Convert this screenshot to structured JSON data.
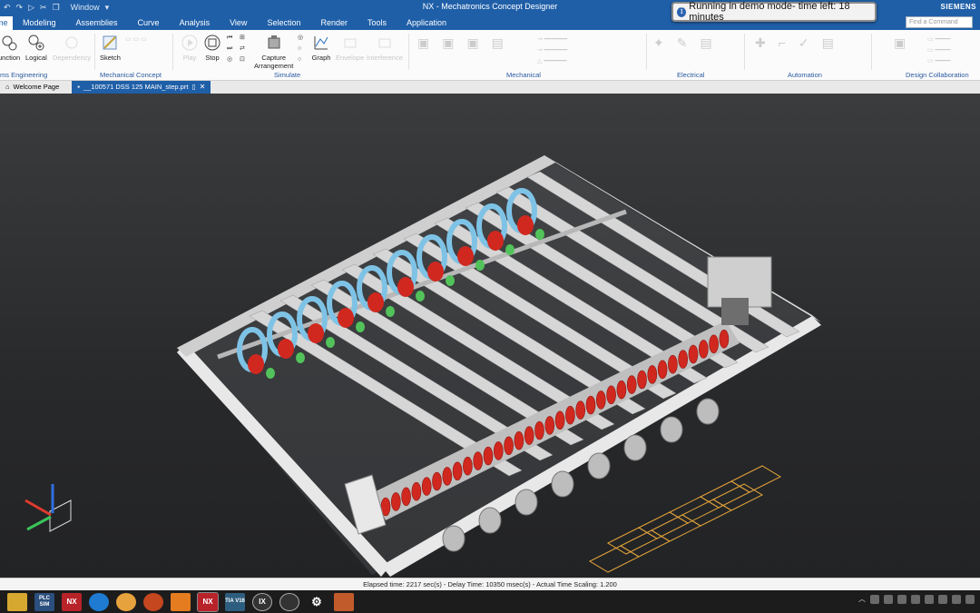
{
  "titlebar": {
    "window_menu": "Window",
    "app_title": "NX - Mechatronics Concept Designer",
    "demo_notice": "Running in demo mode- time left: 18 minutes",
    "brand": "SIEMENS"
  },
  "menu": {
    "tabs": [
      "me",
      "Modeling",
      "Assemblies",
      "Curve",
      "Analysis",
      "View",
      "Selection",
      "Render",
      "Tools",
      "Application"
    ],
    "search_placeholder": "Find a Command"
  },
  "ribbon": {
    "buttons": {
      "function": "unction",
      "logical": "Logical",
      "dependency": "Dependency",
      "sketch": "Sketch",
      "play": "Play",
      "stop": "Stop",
      "capture_line1": "Capture",
      "capture_line2": "Arrangement",
      "graph": "Graph",
      "envelope": "Envelope",
      "interference": "Interference"
    },
    "groups": {
      "systems_engineering": "ms Engineering",
      "mechanical_concept": "Mechanical Concept",
      "simulate": "Simulate",
      "mechanical": "Mechanical",
      "electrical": "Electrical",
      "automation": "Automation",
      "design_collaboration": "Design Collaboration"
    }
  },
  "doc_tabs": {
    "welcome": "Welcome Page",
    "part": "__100571 DSS 125 MAIN_step.prt"
  },
  "status": {
    "text": "Elapsed time: 2217 sec(s) - Delay Time: 10350 msec(s) - Actual Time Scaling: 1.200"
  },
  "taskbar": {
    "apps": [
      "file-explorer",
      "PLC SIM",
      "NX",
      "edge",
      "chrome",
      "powerpoint",
      "vlc",
      "NX",
      "TIA V16",
      "IX",
      "clock",
      "settings",
      "photos"
    ],
    "labels": {
      "plcsim": "PLC SIM",
      "nx": "NX",
      "tia": "TIA V16",
      "ix": "IX"
    }
  },
  "colors": {
    "nx_blue": "#1f5fa8",
    "viewport_bg": "#2a2b2d",
    "roller_red": "#d0281f",
    "belt_blue": "#7ec3e6",
    "guide_green": "#52c35a",
    "frame_white": "#e8e8e8",
    "outline_orange": "#e3a43a"
  }
}
